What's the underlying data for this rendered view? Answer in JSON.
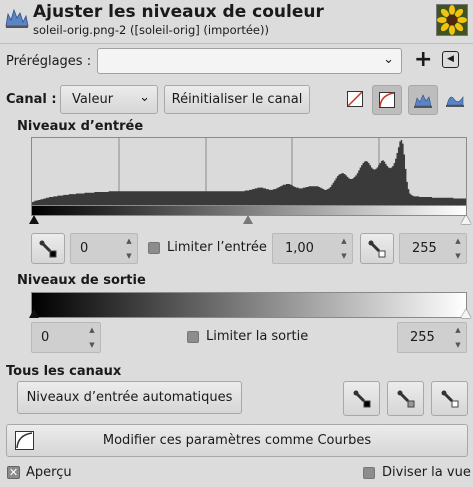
{
  "header": {
    "title": "Ajuster les niveaux de couleur",
    "subtitle": "soleil-orig.png-2 ([soleil-orig] (importée))"
  },
  "presets": {
    "label": "Préréglages :",
    "value": "",
    "add_label": "+"
  },
  "channel": {
    "label": "Canal :",
    "value": "Valeur",
    "reset_label": "Réinitialiser le canal"
  },
  "input_levels": {
    "title": "Niveaux d’entrée",
    "low": "0",
    "gamma": "1,00",
    "high": "255",
    "clamp_label": "Limiter l’entrée",
    "clamp_checked": false
  },
  "output_levels": {
    "title": "Niveaux de sortie",
    "low": "0",
    "high": "255",
    "clamp_label": "Limiter la sortie",
    "clamp_checked": false
  },
  "all_channels": {
    "title": "Tous les canaux",
    "auto_label": "Niveaux d’entrée automatiques"
  },
  "curves_button": {
    "label": "Modifier ces paramètres comme Courbes"
  },
  "footer": {
    "preview_label": "Aperçu",
    "preview_checked": true,
    "split_label": "Diviser la vue",
    "split_checked": false
  },
  "histogram": [
    4,
    5,
    6,
    6,
    7,
    7,
    8,
    8,
    9,
    9,
    10,
    10,
    11,
    11,
    11,
    12,
    12,
    12,
    13,
    13,
    13,
    13,
    14,
    14,
    14,
    14,
    15,
    15,
    15,
    15,
    15,
    16,
    16,
    16,
    16,
    16,
    16,
    17,
    17,
    17,
    17,
    17,
    17,
    17,
    18,
    18,
    18,
    18,
    18,
    18,
    18,
    18,
    18,
    18,
    19,
    19,
    19,
    19,
    19,
    19,
    19,
    19,
    19,
    19,
    19,
    19,
    19,
    19,
    19,
    19,
    19,
    19,
    19,
    19,
    19,
    19,
    19,
    19,
    19,
    19,
    19,
    19,
    19,
    19,
    19,
    19,
    19,
    19,
    19,
    19,
    19,
    19,
    19,
    19,
    19,
    19,
    19,
    19,
    19,
    19,
    19,
    19,
    19,
    19,
    19,
    19,
    19,
    19,
    19,
    19,
    19,
    19,
    19,
    19,
    19,
    19,
    19,
    19,
    19,
    19,
    19,
    19,
    19,
    19,
    19,
    19,
    19,
    19,
    19,
    19,
    19,
    19,
    19,
    19,
    19,
    19,
    19,
    19,
    19,
    19,
    19,
    19,
    19,
    19,
    19,
    19,
    19,
    19,
    19,
    19,
    20,
    20,
    20,
    21,
    21,
    22,
    22,
    23,
    23,
    24,
    24,
    24,
    24,
    23,
    23,
    22,
    22,
    21,
    21,
    21,
    22,
    22,
    23,
    24,
    25,
    26,
    27,
    28,
    28,
    29,
    29,
    29,
    28,
    27,
    26,
    25,
    24,
    24,
    23,
    23,
    23,
    24,
    24,
    25,
    25,
    26,
    26,
    26,
    26,
    26,
    26,
    26,
    25,
    24,
    23,
    22,
    21,
    21,
    22,
    23,
    25,
    28,
    31,
    34,
    37,
    40,
    42,
    43,
    44,
    44,
    43,
    41,
    39,
    37,
    36,
    36,
    37,
    39,
    41,
    44,
    48,
    52,
    55,
    58,
    60,
    61,
    60,
    58,
    55,
    52,
    50,
    49,
    50,
    52,
    55,
    58,
    61,
    62,
    60,
    57,
    54,
    52,
    51,
    52,
    54,
    58,
    64,
    72,
    80,
    88,
    90,
    85,
    70,
    50,
    32,
    22,
    16,
    14,
    13,
    12,
    12,
    12,
    12,
    11,
    11,
    11,
    11,
    11,
    11,
    11,
    11,
    11,
    10,
    10,
    10,
    10,
    10,
    10,
    10,
    10,
    10,
    10,
    10,
    10,
    10,
    10,
    10,
    9,
    9,
    9,
    9,
    9,
    9,
    9,
    9,
    9
  ]
}
